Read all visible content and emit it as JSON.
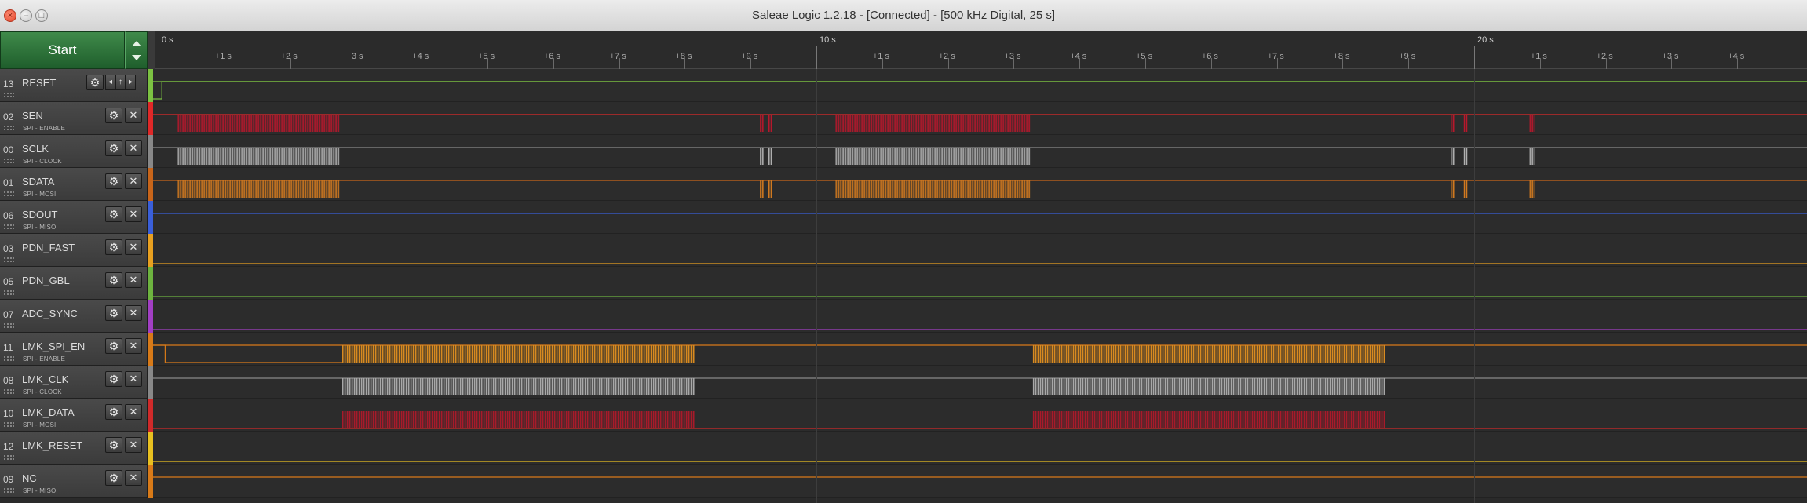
{
  "window": {
    "title": "Saleae Logic 1.2.18 - [Connected] - [500 kHz Digital, 25 s]",
    "close_glyph": "×",
    "min_glyph": "–",
    "max_glyph": "□"
  },
  "toolbar": {
    "start_label": "Start"
  },
  "ruler": {
    "major": [
      {
        "label": "0 s",
        "t": 0
      },
      {
        "label": "10 s",
        "t": 10
      },
      {
        "label": "20 s",
        "t": 20
      }
    ],
    "minor": [
      {
        "label": "+1 s",
        "t": 1
      },
      {
        "label": "+2 s",
        "t": 2
      },
      {
        "label": "+3 s",
        "t": 3
      },
      {
        "label": "+4 s",
        "t": 4
      },
      {
        "label": "+5 s",
        "t": 5
      },
      {
        "label": "+6 s",
        "t": 6
      },
      {
        "label": "+7 s",
        "t": 7
      },
      {
        "label": "+8 s",
        "t": 8
      },
      {
        "label": "+9 s",
        "t": 9
      },
      {
        "label": "+1 s",
        "t": 11
      },
      {
        "label": "+2 s",
        "t": 12
      },
      {
        "label": "+3 s",
        "t": 13
      },
      {
        "label": "+4 s",
        "t": 14
      },
      {
        "label": "+5 s",
        "t": 15
      },
      {
        "label": "+6 s",
        "t": 16
      },
      {
        "label": "+7 s",
        "t": 17
      },
      {
        "label": "+8 s",
        "t": 18
      },
      {
        "label": "+9 s",
        "t": 19
      },
      {
        "label": "+1 s",
        "t": 21
      },
      {
        "label": "+2 s",
        "t": 22
      },
      {
        "label": "+3 s",
        "t": 23
      },
      {
        "label": "+4 s",
        "t": 24
      }
    ]
  },
  "channels": [
    {
      "num": "13",
      "name": "RESET",
      "sub": "",
      "color": "#7cc242",
      "trigger": true,
      "base": "high",
      "bursts": []
    },
    {
      "num": "02",
      "name": "SEN",
      "sub": "SPI - ENABLE",
      "color": "#e02828",
      "base": "high",
      "bursts": [
        [
          0.3,
          2.75,
          "#b8182c"
        ],
        [
          9.15,
          9.2,
          "#b8182c"
        ],
        [
          9.28,
          9.32,
          "#b8182c"
        ],
        [
          10.3,
          13.25,
          "#b8182c"
        ],
        [
          19.65,
          19.7,
          "#b8182c"
        ],
        [
          19.85,
          19.9,
          "#b8182c"
        ],
        [
          20.85,
          20.92,
          "#b8182c"
        ]
      ]
    },
    {
      "num": "00",
      "name": "SCLK",
      "sub": "SPI - CLOCK",
      "color": "#888888",
      "base": "high",
      "bursts": [
        [
          0.3,
          2.75,
          "#b0b0b0"
        ],
        [
          9.15,
          9.2,
          "#b0b0b0"
        ],
        [
          9.28,
          9.32,
          "#b0b0b0"
        ],
        [
          10.3,
          13.25,
          "#b0b0b0"
        ],
        [
          19.65,
          19.7,
          "#b0b0b0"
        ],
        [
          19.85,
          19.9,
          "#b0b0b0"
        ],
        [
          20.85,
          20.92,
          "#b0b0b0"
        ]
      ]
    },
    {
      "num": "01",
      "name": "SDATA",
      "sub": "SPI - MOSI",
      "color": "#c8651a",
      "base": "high",
      "bursts": [
        [
          0.3,
          2.75,
          "#d27a20"
        ],
        [
          9.15,
          9.2,
          "#d27a20"
        ],
        [
          9.28,
          9.32,
          "#d27a20"
        ],
        [
          10.3,
          13.25,
          "#d27a20"
        ],
        [
          19.65,
          19.7,
          "#d27a20"
        ],
        [
          19.85,
          19.9,
          "#d27a20"
        ],
        [
          20.85,
          20.92,
          "#d27a20"
        ]
      ]
    },
    {
      "num": "06",
      "name": "SDOUT",
      "sub": "SPI - MISO",
      "color": "#3a5fd9",
      "base": "high",
      "bursts": []
    },
    {
      "num": "03",
      "name": "PDN_FAST",
      "sub": "",
      "color": "#e8a020",
      "base": "low",
      "bursts": []
    },
    {
      "num": "05",
      "name": "PDN_GBL",
      "sub": "",
      "color": "#6db33f",
      "base": "low",
      "bursts": []
    },
    {
      "num": "07",
      "name": "ADC_SYNC",
      "sub": "",
      "color": "#a23fc4",
      "base": "low",
      "bursts": []
    },
    {
      "num": "11",
      "name": "LMK_SPI_EN",
      "sub": "SPI - ENABLE",
      "color": "#d87a18",
      "base": "lowfirst",
      "bursts": [
        [
          2.8,
          8.15,
          "#d88a20"
        ],
        [
          13.3,
          18.65,
          "#d88a20"
        ]
      ]
    },
    {
      "num": "08",
      "name": "LMK_CLK",
      "sub": "SPI - CLOCK",
      "color": "#888888",
      "base": "high",
      "bursts": [
        [
          2.8,
          8.15,
          "#a8a8a8"
        ],
        [
          13.3,
          18.65,
          "#a8a8a8"
        ]
      ]
    },
    {
      "num": "10",
      "name": "LMK_DATA",
      "sub": "SPI - MOSI",
      "color": "#d02a2a",
      "base": "low",
      "bursts": [
        [
          2.8,
          8.15,
          "#a81a2a"
        ],
        [
          13.3,
          18.65,
          "#a81a2a"
        ]
      ]
    },
    {
      "num": "12",
      "name": "LMK_RESET",
      "sub": "",
      "color": "#e8c020",
      "base": "low",
      "bursts": []
    },
    {
      "num": "09",
      "name": "NC",
      "sub": "SPI - MISO",
      "color": "#d87a18",
      "base": "high",
      "bursts": []
    }
  ]
}
